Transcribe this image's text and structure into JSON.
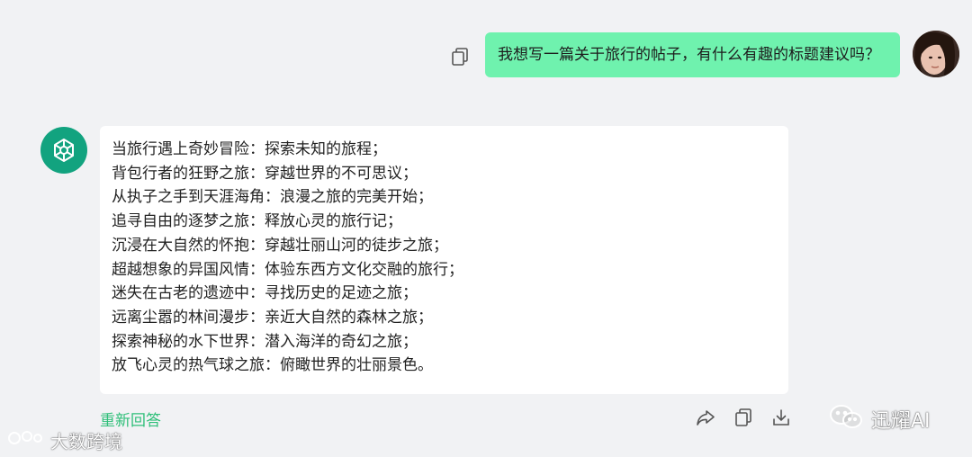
{
  "user_message": {
    "text": "我想写一篇关于旅行的帖子，有什么有趣的标题建议吗？",
    "copy_icon": "copy-icon",
    "avatar": "user-avatar"
  },
  "assistant": {
    "icon": "openai-logo-icon",
    "lines": [
      "当旅行遇上奇妙冒险：探索未知的旅程；",
      "背包行者的狂野之旅：穿越世界的不可思议；",
      "从执子之手到天涯海角：浪漫之旅的完美开始；",
      "追寻自由的逐梦之旅：释放心灵的旅行记；",
      "沉浸在大自然的怀抱：穿越壮丽山河的徒步之旅；",
      "超越想象的异国风情：体验东西方文化交融的旅行；",
      "迷失在古老的遗迹中：寻找历史的足迹之旅；",
      "远离尘嚣的林间漫步：亲近大自然的森林之旅；",
      "探索神秘的水下世界：潜入海洋的奇幻之旅；",
      "放飞心灵的热气球之旅：俯瞰世界的壮丽景色。"
    ]
  },
  "actions": {
    "regenerate_label": "重新回答",
    "icons": [
      "share-icon",
      "copy-icon",
      "download-icon"
    ]
  },
  "watermarks": {
    "right": "迅耀AI",
    "left": "大数跨境"
  },
  "colors": {
    "user_bubble": "#6ff2ae",
    "assistant_avatar": "#12a37f",
    "regenerate": "#2fbf79",
    "background": "#f1f2f4"
  }
}
